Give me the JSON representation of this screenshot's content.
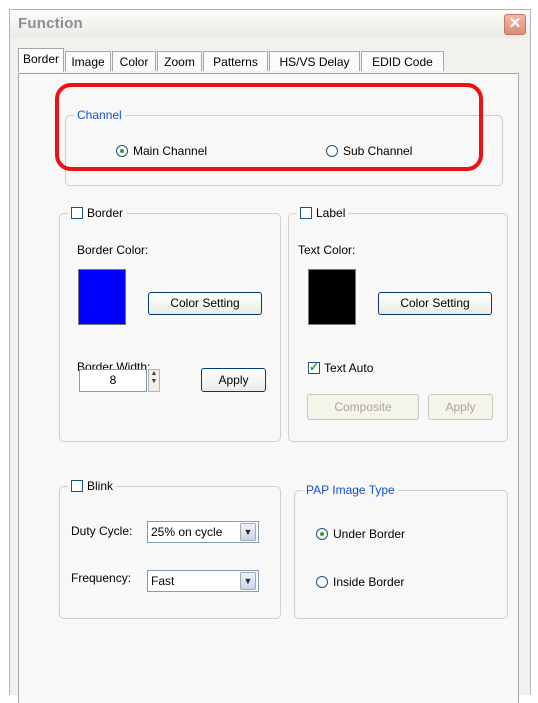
{
  "window": {
    "title": "Function",
    "close_glyph": "✕"
  },
  "tabs": [
    {
      "label": "Border",
      "active": true
    },
    {
      "label": "Image"
    },
    {
      "label": "Color"
    },
    {
      "label": "Zoom"
    },
    {
      "label": "Patterns"
    },
    {
      "label": "HS/VS Delay"
    },
    {
      "label": "EDID Code"
    }
  ],
  "channel": {
    "legend": "Channel",
    "main_label": "Main Channel",
    "sub_label": "Sub Channel",
    "selected": "main"
  },
  "border": {
    "checkbox_label": "Border",
    "checked": false,
    "color_label": "Border Color:",
    "color": "#0000ff",
    "color_setting_label": "Color Setting",
    "width_label": "Border Width:",
    "width_value": "8",
    "apply_label": "Apply"
  },
  "label": {
    "checkbox_label": "Label",
    "checked": false,
    "text_color_label": "Text Color:",
    "color": "#000000",
    "color_setting_label": "Color Setting",
    "text_auto_label": "Text Auto",
    "text_auto_checked": true,
    "composite_label": "Composite",
    "apply_label": "Apply"
  },
  "blink": {
    "checkbox_label": "Blink",
    "checked": false,
    "duty_cycle_label": "Duty Cycle:",
    "duty_cycle_value": "25% on cycle",
    "frequency_label": "Frequency:",
    "frequency_value": "Fast"
  },
  "pap": {
    "legend": "PAP Image Type",
    "under_label": "Under Border",
    "inside_label": "Inside Border",
    "selected": "under"
  },
  "colors": {
    "highlight": "#ee1111",
    "legend_blue": "#1552cc"
  },
  "icons": [
    "close-icon",
    "spin-up-icon",
    "spin-down-icon",
    "dropdown-arrow-icon"
  ]
}
